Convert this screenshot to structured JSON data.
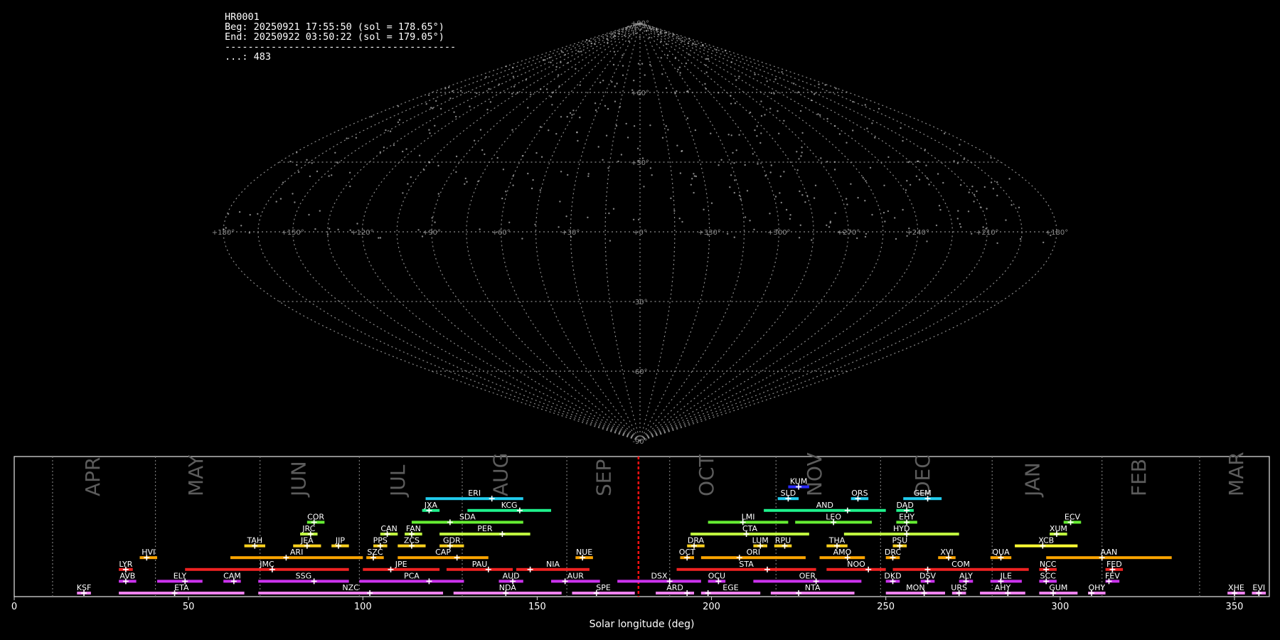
{
  "info": {
    "line1": "HR0001",
    "line2": "Beg: 20250921 17:55:50 (sol = 178.65°)",
    "line3": "End: 20250922 03:50:22 (sol = 179.05°)",
    "line4": "----------------------------------------",
    "line5": "...: 483"
  },
  "chart_data": [
    {
      "type": "scatter",
      "projection": "sinusoidal",
      "grid": true,
      "lat_ticks": [
        "+90°",
        "+60°",
        "+30°",
        "-30°",
        "-60°",
        "-90°"
      ],
      "lon_ticks": [
        "+180°",
        "+150°",
        "+120°",
        "+90°",
        "+60°",
        "+30°",
        "+0°",
        "+330°",
        "+300°",
        "+270°",
        "+240°",
        "+210°",
        "+180°"
      ],
      "point_count": 483
    },
    {
      "type": "bar",
      "xlabel": "Solar longitude (deg)",
      "xlim": [
        0,
        360
      ],
      "xticks": [
        0,
        50,
        100,
        150,
        200,
        250,
        300,
        350
      ],
      "current_sol": 179.05,
      "months": [
        {
          "label": "APR",
          "center": 24.5,
          "start": 11
        },
        {
          "label": "MAY",
          "center": 54,
          "start": 40.5
        },
        {
          "label": "JUN",
          "center": 83.5,
          "start": 70.5
        },
        {
          "label": "JUL",
          "center": 112,
          "start": 99
        },
        {
          "label": "AUG",
          "center": 141.5,
          "start": 128.5
        },
        {
          "label": "SEP",
          "center": 171,
          "start": 158.5
        },
        {
          "label": "OCT",
          "center": 200.5,
          "start": 188
        },
        {
          "label": "NOV",
          "center": 231.5,
          "start": 218.5
        },
        {
          "label": "DEC",
          "center": 262.5,
          "start": 248.5
        },
        {
          "label": "JAN",
          "center": 294,
          "start": 280.5
        },
        {
          "label": "FEB",
          "center": 324.5,
          "start": 312
        },
        {
          "label": "MAR",
          "center": 352.5,
          "start": 340
        }
      ],
      "showers": [
        {
          "code": "KSF",
          "row": 0,
          "start": 18,
          "end": 22,
          "peak": 20,
          "color": "#ee82ee"
        },
        {
          "code": "ETA",
          "row": 0,
          "start": 30,
          "end": 66,
          "peak": 46,
          "color": "#ee82ee"
        },
        {
          "code": "NZC",
          "row": 0,
          "start": 70,
          "end": 123,
          "peak": 102,
          "color": "#ee82ee"
        },
        {
          "code": "NDA",
          "row": 0,
          "start": 126,
          "end": 157,
          "peak": 141,
          "color": "#ee82ee"
        },
        {
          "code": "SPE",
          "row": 0,
          "start": 160,
          "end": 178,
          "peak": 167,
          "color": "#ee82ee"
        },
        {
          "code": "ARD",
          "row": 0,
          "start": 184,
          "end": 195,
          "peak": 193,
          "color": "#ee82ee"
        },
        {
          "code": "EGE",
          "row": 0,
          "start": 197,
          "end": 214,
          "peak": 199,
          "color": "#ee82ee"
        },
        {
          "code": "NTA",
          "row": 0,
          "start": 217,
          "end": 241,
          "peak": 225,
          "color": "#ee82ee"
        },
        {
          "code": "MON",
          "row": 0,
          "start": 250,
          "end": 267,
          "peak": 261,
          "color": "#ee82ee"
        },
        {
          "code": "URS",
          "row": 0,
          "start": 269,
          "end": 273,
          "peak": 271,
          "color": "#ee82ee"
        },
        {
          "code": "AHY",
          "row": 0,
          "start": 277,
          "end": 290,
          "peak": 285,
          "color": "#ee82ee"
        },
        {
          "code": "GUM",
          "row": 0,
          "start": 294,
          "end": 305,
          "peak": 298,
          "color": "#ee82ee"
        },
        {
          "code": "OHY",
          "row": 0,
          "start": 308,
          "end": 313,
          "peak": 309,
          "color": "#ee82ee"
        },
        {
          "code": "XHE",
          "row": 0,
          "start": 348,
          "end": 353,
          "peak": 350,
          "color": "#ee82ee"
        },
        {
          "code": "EVI",
          "row": 0,
          "start": 355,
          "end": 359,
          "peak": 357,
          "color": "#ee82ee"
        },
        {
          "code": "AVB",
          "row": 1,
          "start": 30,
          "end": 35,
          "peak": 32,
          "color": "#cc33ee"
        },
        {
          "code": "ELY",
          "row": 1,
          "start": 41,
          "end": 54,
          "peak": 49,
          "color": "#cc33ee"
        },
        {
          "code": "CAM",
          "row": 1,
          "start": 60,
          "end": 65,
          "peak": 63,
          "color": "#cc33ee"
        },
        {
          "code": "SSG",
          "row": 1,
          "start": 70,
          "end": 96,
          "peak": 86,
          "color": "#cc33ee"
        },
        {
          "code": "PCA",
          "row": 1,
          "start": 99,
          "end": 129,
          "peak": 119,
          "color": "#cc33ee"
        },
        {
          "code": "AUD",
          "row": 1,
          "start": 139,
          "end": 146,
          "peak": 143,
          "color": "#cc33ee"
        },
        {
          "code": "AUR",
          "row": 1,
          "start": 154,
          "end": 168,
          "peak": 158,
          "color": "#cc33ee"
        },
        {
          "code": "DSX",
          "row": 1,
          "start": 173,
          "end": 197,
          "peak": 188,
          "color": "#cc33ee"
        },
        {
          "code": "OCU",
          "row": 1,
          "start": 199,
          "end": 204,
          "peak": 202,
          "color": "#cc33ee"
        },
        {
          "code": "OER",
          "row": 1,
          "start": 212,
          "end": 243,
          "peak": 230,
          "color": "#cc33ee"
        },
        {
          "code": "DKD",
          "row": 1,
          "start": 250,
          "end": 254,
          "peak": 252,
          "color": "#cc33ee"
        },
        {
          "code": "DSV",
          "row": 1,
          "start": 260,
          "end": 264,
          "peak": 262,
          "color": "#cc33ee"
        },
        {
          "code": "ALY",
          "row": 1,
          "start": 271,
          "end": 275,
          "peak": 273,
          "color": "#cc33ee"
        },
        {
          "code": "JLE",
          "row": 1,
          "start": 280,
          "end": 289,
          "peak": 283,
          "color": "#cc33ee"
        },
        {
          "code": "SCC",
          "row": 1,
          "start": 294,
          "end": 299,
          "peak": 296,
          "color": "#cc33ee"
        },
        {
          "code": "FEV",
          "row": 1,
          "start": 313,
          "end": 317,
          "peak": 314,
          "color": "#cc33ee"
        },
        {
          "code": "LYR",
          "row": 2,
          "start": 30,
          "end": 34,
          "peak": 32,
          "color": "#ee2222"
        },
        {
          "code": "JMC",
          "row": 2,
          "start": 49,
          "end": 96,
          "peak": 74,
          "color": "#ee2222"
        },
        {
          "code": "JPE",
          "row": 2,
          "start": 100,
          "end": 122,
          "peak": 108,
          "color": "#ee2222"
        },
        {
          "code": "PAU",
          "row": 2,
          "start": 124,
          "end": 143,
          "peak": 136,
          "color": "#ee2222"
        },
        {
          "code": "NIA",
          "row": 2,
          "start": 144,
          "end": 165,
          "peak": 148,
          "color": "#ee2222"
        },
        {
          "code": "STA",
          "row": 2,
          "start": 190,
          "end": 230,
          "peak": 216,
          "color": "#ee2222"
        },
        {
          "code": "NOO",
          "row": 2,
          "start": 233,
          "end": 250,
          "peak": 245,
          "color": "#ee2222"
        },
        {
          "code": "COM",
          "row": 2,
          "start": 252,
          "end": 291,
          "peak": 262,
          "color": "#ee2222"
        },
        {
          "code": "NCC",
          "row": 2,
          "start": 294,
          "end": 299,
          "peak": 296,
          "color": "#ee2222"
        },
        {
          "code": "FED",
          "row": 2,
          "start": 313,
          "end": 318,
          "peak": 315,
          "color": "#ee2222"
        },
        {
          "code": "HVI",
          "row": 3,
          "start": 36,
          "end": 41,
          "peak": 38,
          "color": "#ffa500"
        },
        {
          "code": "ARI",
          "row": 3,
          "start": 62,
          "end": 100,
          "peak": 78,
          "color": "#ffa500"
        },
        {
          "code": "SZC",
          "row": 3,
          "start": 101,
          "end": 106,
          "peak": 103,
          "color": "#ffa500"
        },
        {
          "code": "CAP",
          "row": 3,
          "start": 110,
          "end": 136,
          "peak": 127,
          "color": "#ffa500"
        },
        {
          "code": "NUE",
          "row": 3,
          "start": 161,
          "end": 166,
          "peak": 163,
          "color": "#ffa500"
        },
        {
          "code": "OCT",
          "row": 3,
          "start": 191,
          "end": 195,
          "peak": 193,
          "color": "#ffa500"
        },
        {
          "code": "ORI",
          "row": 3,
          "start": 197,
          "end": 227,
          "peak": 208,
          "color": "#ffa500"
        },
        {
          "code": "AMO",
          "row": 3,
          "start": 231,
          "end": 244,
          "peak": 239,
          "color": "#ffa500"
        },
        {
          "code": "DRC",
          "row": 3,
          "start": 250,
          "end": 254,
          "peak": 252,
          "color": "#ffa500"
        },
        {
          "code": "XVI",
          "row": 3,
          "start": 265,
          "end": 270,
          "peak": 268,
          "color": "#ffa500"
        },
        {
          "code": "QUA",
          "row": 3,
          "start": 280,
          "end": 286,
          "peak": 283,
          "color": "#ffa500"
        },
        {
          "code": "AAN",
          "row": 3,
          "start": 296,
          "end": 332,
          "peak": 312,
          "color": "#ffa500"
        },
        {
          "code": "TAH",
          "row": 4,
          "start": 66,
          "end": 72,
          "peak": 69,
          "color": "#ffd21e"
        },
        {
          "code": "JEA",
          "row": 4,
          "start": 80,
          "end": 88,
          "peak": 84,
          "color": "#ffd21e"
        },
        {
          "code": "JIP",
          "row": 4,
          "start": 91,
          "end": 96,
          "peak": 93,
          "color": "#ffd21e"
        },
        {
          "code": "PPS",
          "row": 4,
          "start": 103,
          "end": 107,
          "peak": 105,
          "color": "#ffd21e"
        },
        {
          "code": "ZCS",
          "row": 4,
          "start": 110,
          "end": 118,
          "peak": 114,
          "color": "#ffd21e"
        },
        {
          "code": "GDR",
          "row": 4,
          "start": 122,
          "end": 129,
          "peak": 125,
          "color": "#ffd21e"
        },
        {
          "code": "DRA",
          "row": 4,
          "start": 193,
          "end": 198,
          "peak": 195,
          "color": "#ffd21e"
        },
        {
          "code": "LUM",
          "row": 4,
          "start": 212,
          "end": 216,
          "peak": 214,
          "color": "#ffd21e"
        },
        {
          "code": "RPU",
          "row": 4,
          "start": 218,
          "end": 223,
          "peak": 221,
          "color": "#ffd21e"
        },
        {
          "code": "THA",
          "row": 4,
          "start": 233,
          "end": 239,
          "peak": 236,
          "color": "#ffd21e"
        },
        {
          "code": "PSU",
          "row": 4,
          "start": 252,
          "end": 256,
          "peak": 254,
          "color": "#ffd21e"
        },
        {
          "code": "XCB",
          "row": 4,
          "start": 287,
          "end": 305,
          "peak": 295,
          "color": "#ffff33"
        },
        {
          "code": "JRC",
          "row": 5,
          "start": 82,
          "end": 87,
          "peak": 85,
          "color": "#bfff3f"
        },
        {
          "code": "CAN",
          "row": 5,
          "start": 105,
          "end": 110,
          "peak": 107,
          "color": "#bfff3f"
        },
        {
          "code": "FAN",
          "row": 5,
          "start": 112,
          "end": 117,
          "peak": 114,
          "color": "#bfff3f"
        },
        {
          "code": "PER",
          "row": 5,
          "start": 122,
          "end": 148,
          "peak": 140,
          "color": "#bfff3f"
        },
        {
          "code": "CTA",
          "row": 5,
          "start": 194,
          "end": 228,
          "peak": 210,
          "color": "#bfff3f"
        },
        {
          "code": "HYD",
          "row": 5,
          "start": 238,
          "end": 271,
          "peak": 256,
          "color": "#bfff3f"
        },
        {
          "code": "XUM",
          "row": 5,
          "start": 297,
          "end": 302,
          "peak": 299,
          "color": "#bfff3f"
        },
        {
          "code": "COR",
          "row": 6,
          "start": 84,
          "end": 89,
          "peak": 86,
          "color": "#66ee33"
        },
        {
          "code": "SDA",
          "row": 6,
          "start": 114,
          "end": 146,
          "peak": 125,
          "color": "#66ee33"
        },
        {
          "code": "LMI",
          "row": 6,
          "start": 199,
          "end": 222,
          "peak": 209,
          "color": "#66ee33"
        },
        {
          "code": "LEO",
          "row": 6,
          "start": 224,
          "end": 246,
          "peak": 235,
          "color": "#66ee33"
        },
        {
          "code": "EHY",
          "row": 6,
          "start": 253,
          "end": 259,
          "peak": 256,
          "color": "#66ee33"
        },
        {
          "code": "ECV",
          "row": 6,
          "start": 301,
          "end": 306,
          "peak": 303,
          "color": "#66ee33"
        },
        {
          "code": "JXA",
          "row": 7,
          "start": 117,
          "end": 122,
          "peak": 119,
          "color": "#1ef08c"
        },
        {
          "code": "KCG",
          "row": 7,
          "start": 130,
          "end": 154,
          "peak": 145,
          "color": "#1ef08c"
        },
        {
          "code": "AND",
          "row": 7,
          "start": 215,
          "end": 250,
          "peak": 239,
          "color": "#1ef08c"
        },
        {
          "code": "DAD",
          "row": 7,
          "start": 253,
          "end": 258,
          "peak": 256,
          "color": "#1ef08c"
        },
        {
          "code": "ERI",
          "row": 8,
          "start": 118,
          "end": 146,
          "peak": 137,
          "color": "#22ccee"
        },
        {
          "code": "SLD",
          "row": 8,
          "start": 219,
          "end": 225,
          "peak": 222,
          "color": "#22ccee"
        },
        {
          "code": "ORS",
          "row": 8,
          "start": 240,
          "end": 245,
          "peak": 242,
          "color": "#22ccee"
        },
        {
          "code": "GEM",
          "row": 8,
          "start": 255,
          "end": 266,
          "peak": 262,
          "color": "#22ccee"
        },
        {
          "code": "KUM",
          "row": 9,
          "start": 222,
          "end": 228,
          "peak": 225,
          "color": "#2a2aff"
        }
      ]
    }
  ]
}
